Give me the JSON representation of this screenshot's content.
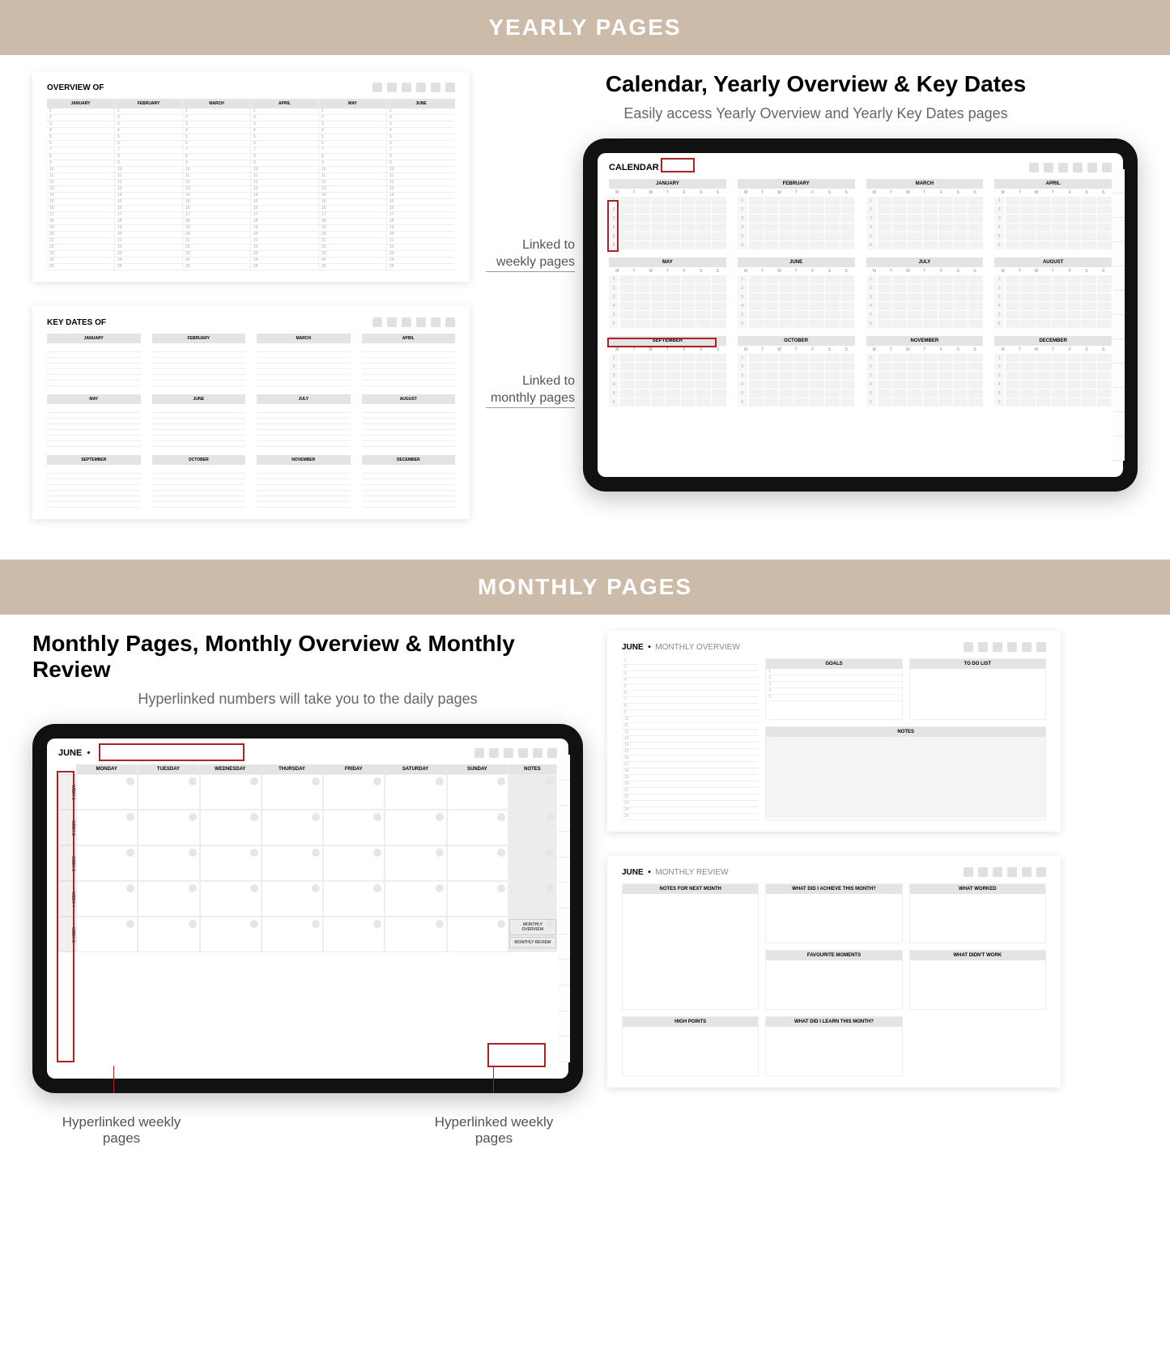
{
  "banners": {
    "yearly": "YEARLY PAGES",
    "monthly": "MONTHLY PAGES"
  },
  "yearly": {
    "overview_title": "OVERVIEW OF",
    "keydates_title": "KEY DATES OF",
    "months": [
      "JANUARY",
      "FEBRUARY",
      "MARCH",
      "APRIL",
      "MAY",
      "JUNE",
      "JULY",
      "AUGUST",
      "SEPTEMBER",
      "OCTOBER",
      "NOVEMBER",
      "DECEMBER"
    ],
    "overview_months_top6": [
      "JANUARY",
      "FEBRUARY",
      "MARCH",
      "APRIL",
      "MAY",
      "JUNE"
    ],
    "row_numbers": [
      "1",
      "2",
      "3",
      "4",
      "5",
      "6",
      "7",
      "8",
      "9",
      "10",
      "11",
      "12",
      "13",
      "14",
      "15",
      "16",
      "17",
      "18",
      "19",
      "20",
      "21",
      "22",
      "23",
      "24",
      "25"
    ],
    "promo_h": "Calendar, Yearly Overview & Key Dates",
    "promo_sub": "Easily access Yearly Overview and Yearly Key Dates pages",
    "callout_weekly": "Linked to weekly pages",
    "callout_monthly": "Linked to monthly pages",
    "calendar_title": "CALENDAR",
    "dow": [
      "M",
      "T",
      "W",
      "T",
      "F",
      "S",
      "S"
    ],
    "wknums": [
      "1",
      "2",
      "3",
      "4",
      "5",
      "6"
    ]
  },
  "monthly": {
    "promo_h": "Monthly Pages, Monthly Overview & Monthly Review",
    "promo_sub": "Hyperlinked numbers will take you to the daily pages",
    "callout_bottom_left": "Hyperlinked weekly pages",
    "callout_bottom_right": "Hyperlinked weekly pages",
    "month_label": "JUNE",
    "overview_label": "MONTHLY OVERVIEW",
    "review_label": "MONTHLY REVIEW",
    "days": [
      "MONDAY",
      "TUESDAY",
      "WEDNESDAY",
      "THURSDAY",
      "FRIDAY",
      "SATURDAY",
      "SUNDAY"
    ],
    "notes_label": "NOTES",
    "weeks": [
      "WEEK 1",
      "WEEK 2",
      "WEEK 3",
      "WEEK 4",
      "WEEK 5"
    ],
    "link_overview": "MONTHLY OVERVIEW",
    "link_review": "MONTHLY REVIEW",
    "ov_goals": "GOALS",
    "ov_todo": "TO DO LIST",
    "ov_notes": "NOTES",
    "rv_achieve": "WHAT DID I ACHIEVE THIS MONTH?",
    "rv_worked": "WHAT WORKED",
    "rv_notwork": "WHAT DIDN'T WORK",
    "rv_next": "NOTES FOR NEXT MONTH",
    "rv_fav": "FAVOURITE MOMENTS",
    "rv_learn": "WHAT DID I LEARN THIS MONTH?",
    "rv_high": "HIGH POINTS"
  }
}
